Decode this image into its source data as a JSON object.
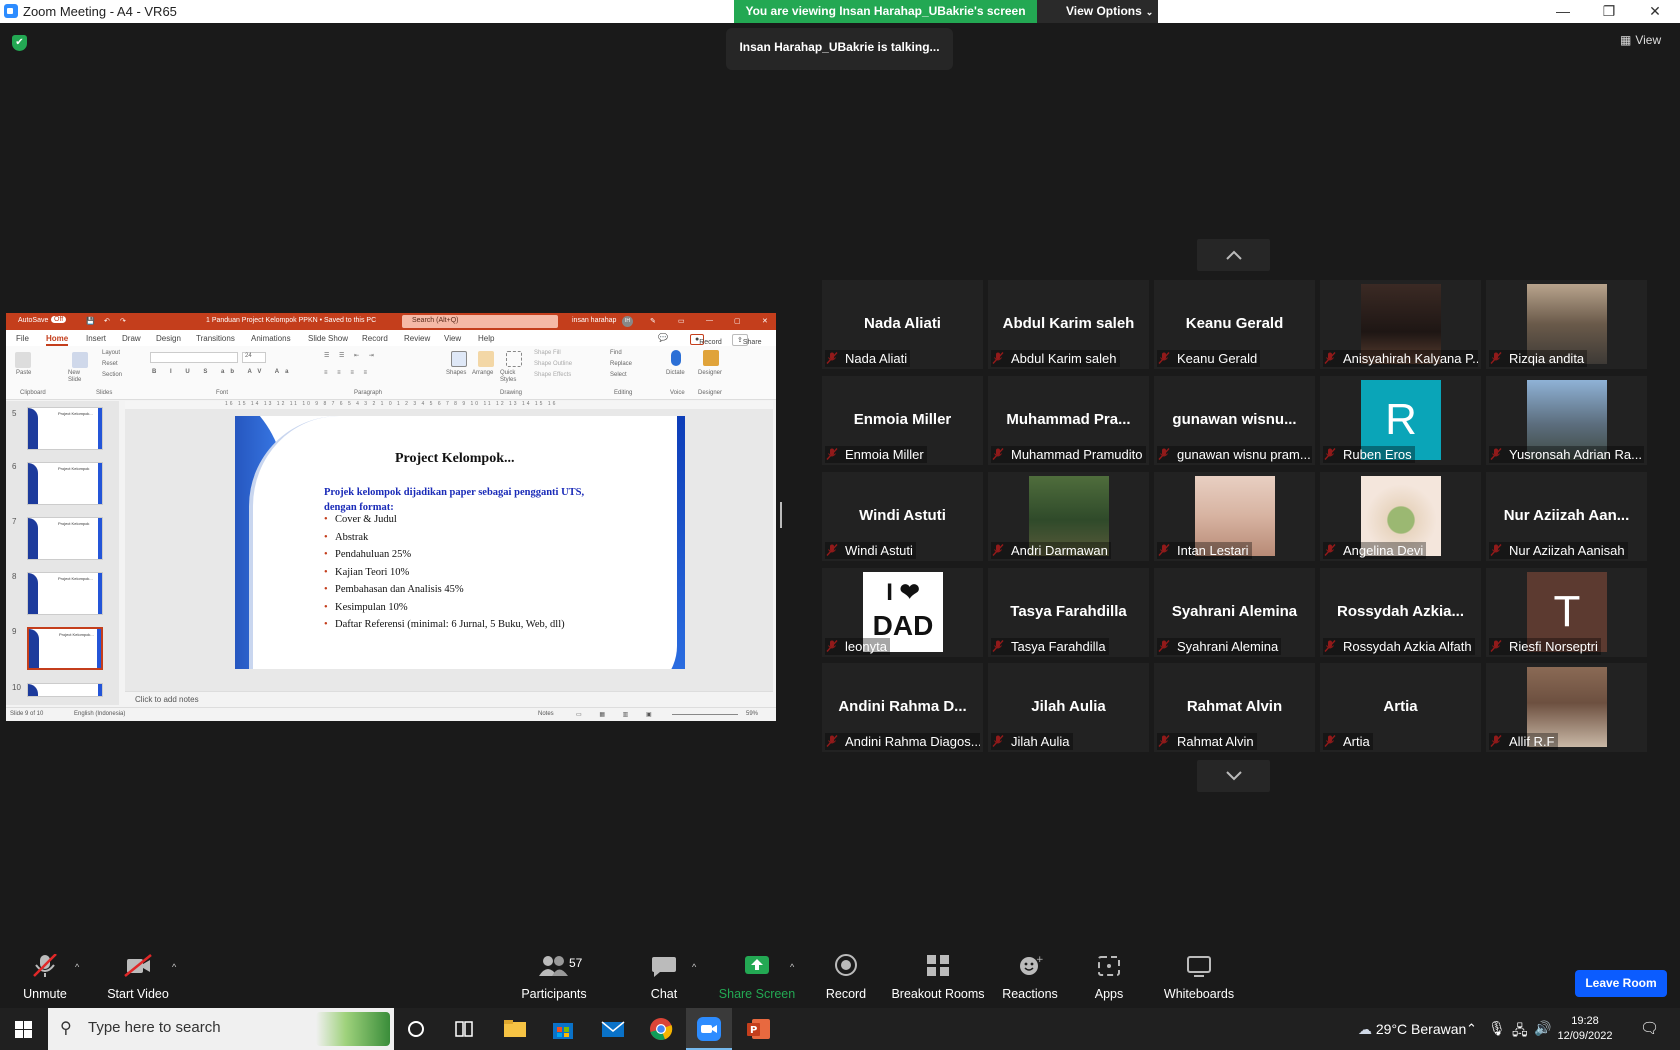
{
  "window": {
    "title": "Zoom Meeting - A4 - VR65",
    "minimize": "—",
    "restore": "❐",
    "close": "✕"
  },
  "banner": {
    "viewing": "You are viewing Insan Harahap_UBakrie's screen",
    "view_options": "View Options"
  },
  "talking": "Insan Harahap_UBakrie is talking...",
  "view_button": "View",
  "ppt": {
    "autosave": "AutoSave",
    "autosave_state": "Off",
    "doc_title": "1 Panduan Project Kelompok PPKN • Saved to this PC",
    "search": "Search (Alt+Q)",
    "user": "insan harahap",
    "user_initial": "IH",
    "tabs": [
      "File",
      "Home",
      "Insert",
      "Draw",
      "Design",
      "Transitions",
      "Animations",
      "Slide Show",
      "Record",
      "Review",
      "View",
      "Help"
    ],
    "record": "Record",
    "share": "Share",
    "groups": [
      "Clipboard",
      "Slides",
      "Font",
      "Paragraph",
      "Drawing",
      "Editing",
      "Voice",
      "Designer"
    ],
    "ribbon_items": {
      "paste": "Paste",
      "new_slide": "New Slide",
      "layout": "Layout",
      "reset": "Reset",
      "section": "Section",
      "font_size": "24",
      "shapes": "Shapes",
      "arrange": "Arrange",
      "quick_styles": "Quick Styles",
      "shape_fill": "Shape Fill",
      "shape_outline": "Shape Outline",
      "shape_effects": "Shape Effects",
      "find": "Find",
      "replace": "Replace",
      "select": "Select",
      "dictate": "Dictate",
      "designer": "Designer"
    },
    "thumb_numbers": [
      "5",
      "6",
      "7",
      "8",
      "9",
      "10"
    ],
    "thumb_titles": [
      "Project Kelompok...",
      "Project Kelompok",
      "Project Kelompok",
      "Project Kelompok...",
      "Project Kelompok..."
    ],
    "ruler": "16 15 14 13 12 11 10 9 8 7 6 5 4 3 2 1 0 1 2 3 4 5 6 7 8 9 10 11 12 13 14 15 16",
    "slide": {
      "title": "Project Kelompok...",
      "subtitle": "Projek kelompok dijadikan paper sebagai pengganti UTS, dengan format:",
      "items": [
        "Cover & Judul",
        "Abstrak",
        "Pendahuluan 25%",
        "Kajian Teori 10%",
        "Pembahasan dan Analisis 45%",
        "Kesimpulan 10%",
        "Daftar Referensi (minimal: 6 Jurnal, 5 Buku, Web, dll)"
      ]
    },
    "notes": "Click to add notes",
    "status_slide": "Slide 9 of 10",
    "status_lang": "English (Indonesia)",
    "status_notes": "Notes",
    "zoom": "59%"
  },
  "participants_grid": [
    {
      "label": "Nada Aliati",
      "big": "Nada Aliati"
    },
    {
      "label": "Abdul Karim saleh",
      "big": "Abdul Karim saleh"
    },
    {
      "label": "Keanu Gerald",
      "big": "Keanu Gerald"
    },
    {
      "label": "Anisyahirah Kalyana P...",
      "avatar": "photo-woman"
    },
    {
      "label": "Rizqia andita",
      "avatar": "photo-storefront"
    },
    {
      "label": "Enmoia Miller",
      "big": "Enmoia Miller"
    },
    {
      "label": "Muhammad Pramudito",
      "big": "Muhammad Pra..."
    },
    {
      "label": "gunawan wisnu pram...",
      "big": "gunawan wisnu..."
    },
    {
      "label": "Ruben Eros",
      "avatar_letter": "R"
    },
    {
      "label": "Yusronsah Adrian Ra...",
      "avatar": "photo-group"
    },
    {
      "label": "Windi Astuti",
      "big": "Windi Astuti"
    },
    {
      "label": "Andri Darmawan",
      "avatar": "photo-outdoor"
    },
    {
      "label": "Intan Lestari",
      "avatar": "photo-portrait"
    },
    {
      "label": "Angelina Devi",
      "avatar": "photo-baby-yoda"
    },
    {
      "label": "Nur Aziizah Aanisah",
      "big": "Nur Aziizah Aan..."
    },
    {
      "label": "leonyta",
      "avatar_text": [
        "I ❤",
        "DAD"
      ]
    },
    {
      "label": "Tasya Farahdilla",
      "big": "Tasya Farahdilla"
    },
    {
      "label": "Syahrani Alemina",
      "big": "Syahrani Alemina"
    },
    {
      "label": "Rossydah Azkia Alfath",
      "big": "Rossydah Azkia..."
    },
    {
      "label": "Riesfi Norseptri",
      "avatar_letter": "T"
    },
    {
      "label": "Andini Rahma Diagos...",
      "big": "Andini Rahma D..."
    },
    {
      "label": "Jilah Aulia",
      "big": "Jilah Aulia"
    },
    {
      "label": "Rahmat Alvin",
      "big": "Rahmat Alvin"
    },
    {
      "label": "Artia",
      "big": "Artia"
    },
    {
      "label": "Allif R.F",
      "avatar": "photo-park"
    }
  ],
  "toolbar": {
    "unmute": "Unmute",
    "start_video": "Start Video",
    "participants": "Participants",
    "participants_count": "57",
    "chat": "Chat",
    "share_screen": "Share Screen",
    "record": "Record",
    "breakout": "Breakout Rooms",
    "reactions": "Reactions",
    "apps": "Apps",
    "whiteboards": "Whiteboards",
    "leave": "Leave Room"
  },
  "taskbar": {
    "search_placeholder": "Type here to search",
    "weather": "29°C  Berawan",
    "time": "19:28",
    "date": "12/09/2022"
  },
  "colors": {
    "zoom_green": "#23a853",
    "zoom_blue": "#0b5cff",
    "ppt_red": "#c43e1c",
    "mute_red": "#e02828"
  }
}
